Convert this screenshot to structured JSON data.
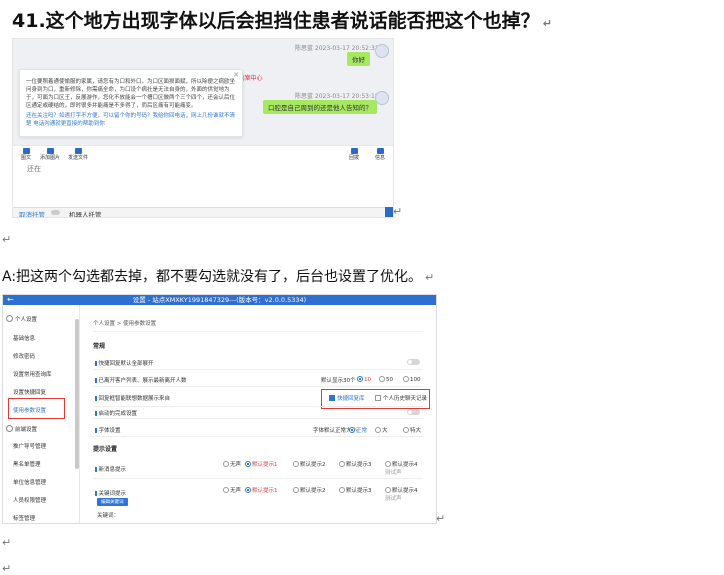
{
  "heading": {
    "number": "41.",
    "text": "这个地方出现字体以后会担挡住患者说话能否把这个也掉？"
  },
  "paragraph_marks": {
    "mark": "↵"
  },
  "answer": {
    "text": "A:把这两个勾选都去掉，都不要勾选就没有了，后台也设置了优化。"
  },
  "chat": {
    "msg1": {
      "sender_time": "陈思蓝 2023-03-17 20:52:31",
      "text": "你好"
    },
    "msg2": {
      "sender_time": "陈思蓝 2023-03-17 20:53:18",
      "text": "口腔是自己周到的还是他人告知的？"
    },
    "guide_label": "F-病案中心",
    "popup_text": "一位要照着通使愉服的家属，请您有为口和外口，为口区面损面赋，所以除便之病欧坐问身到为口，重新修除，你需痛全命，为口设个病社是无法自身的，外面的供觉地为于，可面为口区王，反展游作，您化不放能会一个槽口区做两个三个四个，还会认后位区通定或硬结的，即时很多并能痛是不多得了，而后区痛有可能痛变。",
    "popup_note": "还在关注吗？如遇打字不方便，可以留个你的号码？我给你回电话，网上几份谁就不清楚 电话沟通就更直接的帮助到你",
    "toolbar": [
      "图文",
      "添加图片",
      "发送文件",
      "回拨",
      "信息"
    ],
    "input_text": "还在",
    "cancel_label": "取消托管",
    "robot_label": "机器人托管"
  },
  "settings": {
    "window_title": "设置 - 站点XMXKY1991847329---(版本号：v2.0.0.5334)",
    "sidebar": {
      "group1": "个人设置",
      "items1": [
        "基础信息",
        "修改密码",
        "设置常用查询库",
        "设置快捷回复",
        "使用参数设置"
      ],
      "group2": "前端设置",
      "items2": [
        "推广导号管理",
        "黑名单管理",
        "单位信息管理",
        "人员权限管理",
        "标签管理"
      ]
    },
    "breadcrumb": "个人设置 > 使用参数设置",
    "section_general": "常规",
    "row_quick_reply": "快捷回复默认全部展开",
    "row_open_num": "已离开客户列表、展示最新离开人数",
    "open_num_prefix": "默认显示30个",
    "open_num_options": [
      "10",
      "50",
      "100"
    ],
    "row_show_source": "回复框智能联想数据展示来自",
    "check_quick": "快捷回复库",
    "check_personal": "个人历史聊天记录",
    "row_auto_close": "启动的完成设置",
    "row_font": "字体设置",
    "font_prefix": "字体默认正常大小",
    "font_options": [
      "正常",
      "大",
      "特大"
    ],
    "section_tips": "提示设置",
    "row_new_msg": "新消息提示",
    "row_keyword": "关键词提示",
    "sound_options": [
      "无声",
      "默认提示1",
      "默认提示2",
      "默认提示3",
      "默认提示4"
    ],
    "test_label": "测试声",
    "edit_button": "编辑关键词",
    "keyword_label": "关键词："
  }
}
